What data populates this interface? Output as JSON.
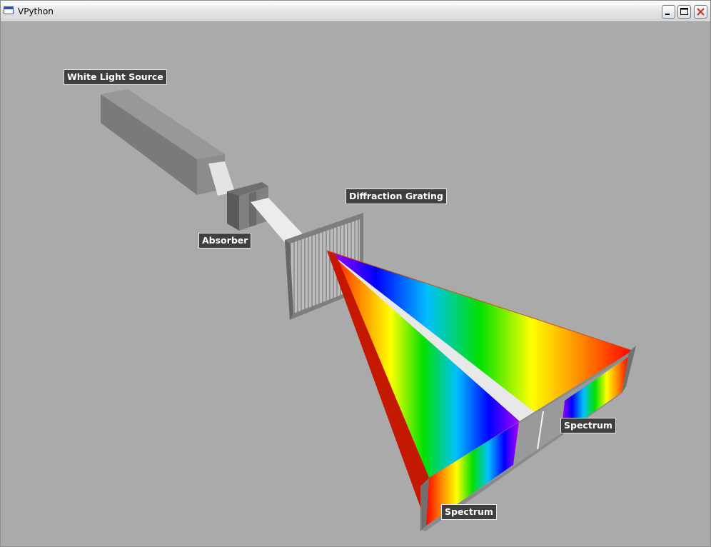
{
  "window": {
    "title": "VPython"
  },
  "labels": {
    "source": "White Light Source",
    "absorber": "Absorber",
    "grating": "Diffraction Grating",
    "spectrum_right": "Spectrum",
    "spectrum_bottom": "Spectrum"
  },
  "colors": {
    "background": "#aaaaaa",
    "label_bg": "#3f3f3f",
    "beam": "#e6e6e6"
  },
  "icons": {
    "app": "app-window-icon",
    "minimize": "minimize-icon",
    "maximize": "maximize-icon",
    "close": "close-icon"
  }
}
